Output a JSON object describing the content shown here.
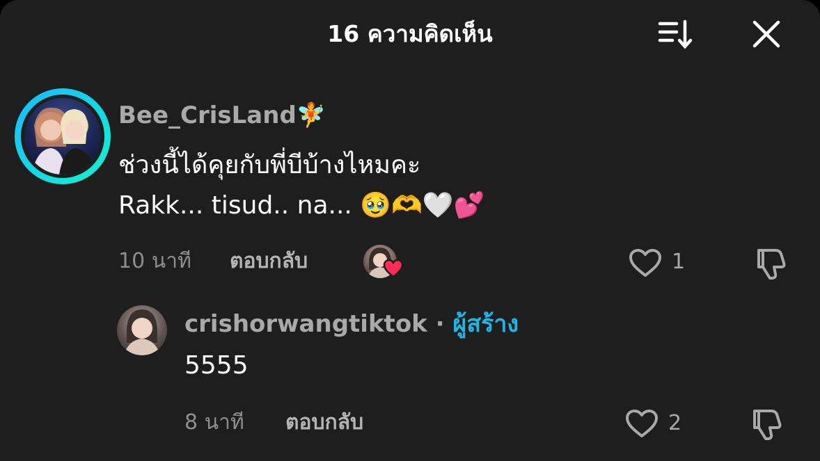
{
  "header": {
    "title": "16 ความคิดเห็น"
  },
  "comment": {
    "username": "Bee_CrisLand",
    "username_emoji": "🧚",
    "line1": "ช่วงนี้ได้คุยกับพี่บีบ้างไหมคะ",
    "line2": "Rakk... tisud.. na... 🥹🫶🤍💕",
    "time": "10 นาที",
    "reply_label": "ตอบกลับ",
    "like_count": "1"
  },
  "reply": {
    "username": "crishorwangtiktok",
    "separator": "·",
    "creator_label": "ผู้สร้าง",
    "text": "5555",
    "time": "8 นาที",
    "reply_label": "ตอบกลับ",
    "like_count": "2"
  },
  "colors": {
    "background": "#1e1e1e",
    "creator_accent": "#20b5e6",
    "ring_gradient": [
      "#1fb6ff",
      "#17f2c8"
    ],
    "heart_badge": "#fe2c55"
  },
  "icons": {
    "sort": "sort-icon",
    "close": "close-icon",
    "like": "heart-outline-icon",
    "dislike": "thumbs-down-icon",
    "creator_liked": "heart-badge-icon"
  }
}
